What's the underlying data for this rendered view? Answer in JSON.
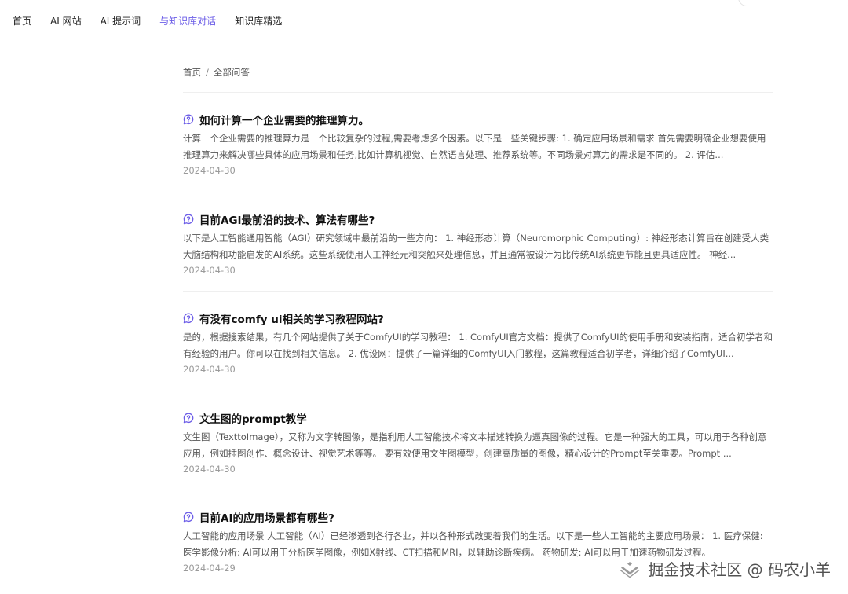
{
  "nav": {
    "items": [
      "首页",
      "AI 网站",
      "AI 提示词",
      "与知识库对话",
      "知识库精选"
    ],
    "active_index": 3,
    "accent_color": "#6b5ce7"
  },
  "breadcrumb": {
    "home": "首页",
    "separator": "/",
    "current": "全部问答"
  },
  "questions": [
    {
      "title": "如何计算一个企业需要的推理算力。",
      "desc": "计算一个企业需要的推理算力是一个比较复杂的过程,需要考虑多个因素。以下是一些关键步骤: 1. 确定应用场景和需求 首先需要明确企业想要使用推理算力来解决哪些具体的应用场景和任务,比如计算机视觉、自然语言处理、推荐系统等。不同场景对算力的需求是不同的。 2. 评估...",
      "date": "2024-04-30"
    },
    {
      "title": "目前AGI最前沿的技术、算法有哪些?",
      "desc": "以下是人工智能通用智能（AGI）研究领域中最前沿的一些方向： 1. 神经形态计算（Neuromorphic Computing）: 神经形态计算旨在创建受人类大脑结构和功能启发的AI系统。这些系统使用人工神经元和突触来处理信息，并且通常被设计为比传统AI系统更节能且更具适应性。 神经...",
      "date": "2024-04-30"
    },
    {
      "title": "有没有comfy ui相关的学习教程网站?",
      "desc": "是的，根据搜索结果，有几个网站提供了关于ComfyUI的学习教程： 1. ComfyUI官方文档：提供了ComfyUI的使用手册和安装指南，适合初学者和有经验的用户。你可以在找到相关信息。 2. 优设网：提供了一篇详细的ComfyUI入门教程，这篇教程适合初学者，详细介绍了ComfyUI...",
      "date": "2024-04-30"
    },
    {
      "title": "文生图的prompt教学",
      "desc": "文生图（TexttoImage），又称为文字转图像，是指利用人工智能技术将文本描述转换为逼真图像的过程。它是一种强大的工具，可以用于各种创意应用，例如插图创作、概念设计、视觉艺术等等。 要有效使用文生图模型，创建高质量的图像，精心设计的Prompt至关重要。Prompt ...",
      "date": "2024-04-30"
    },
    {
      "title": "目前AI的应用场景都有哪些?",
      "desc": "人工智能的应用场景 人工智能（AI）已经渗透到各行各业，并以各种形式改变着我们的生活。以下是一些人工智能的主要应用场景： 1. 医疗保健: 医学影像分析: AI可以用于分析医学图像，例如X射线、CT扫描和MRI，以辅助诊断疾病。 药物研发: AI可以用于加速药物研发过程。",
      "date": "2024-04-29"
    }
  ],
  "watermark": {
    "text": "掘金技术社区 @ 码农小羊"
  }
}
